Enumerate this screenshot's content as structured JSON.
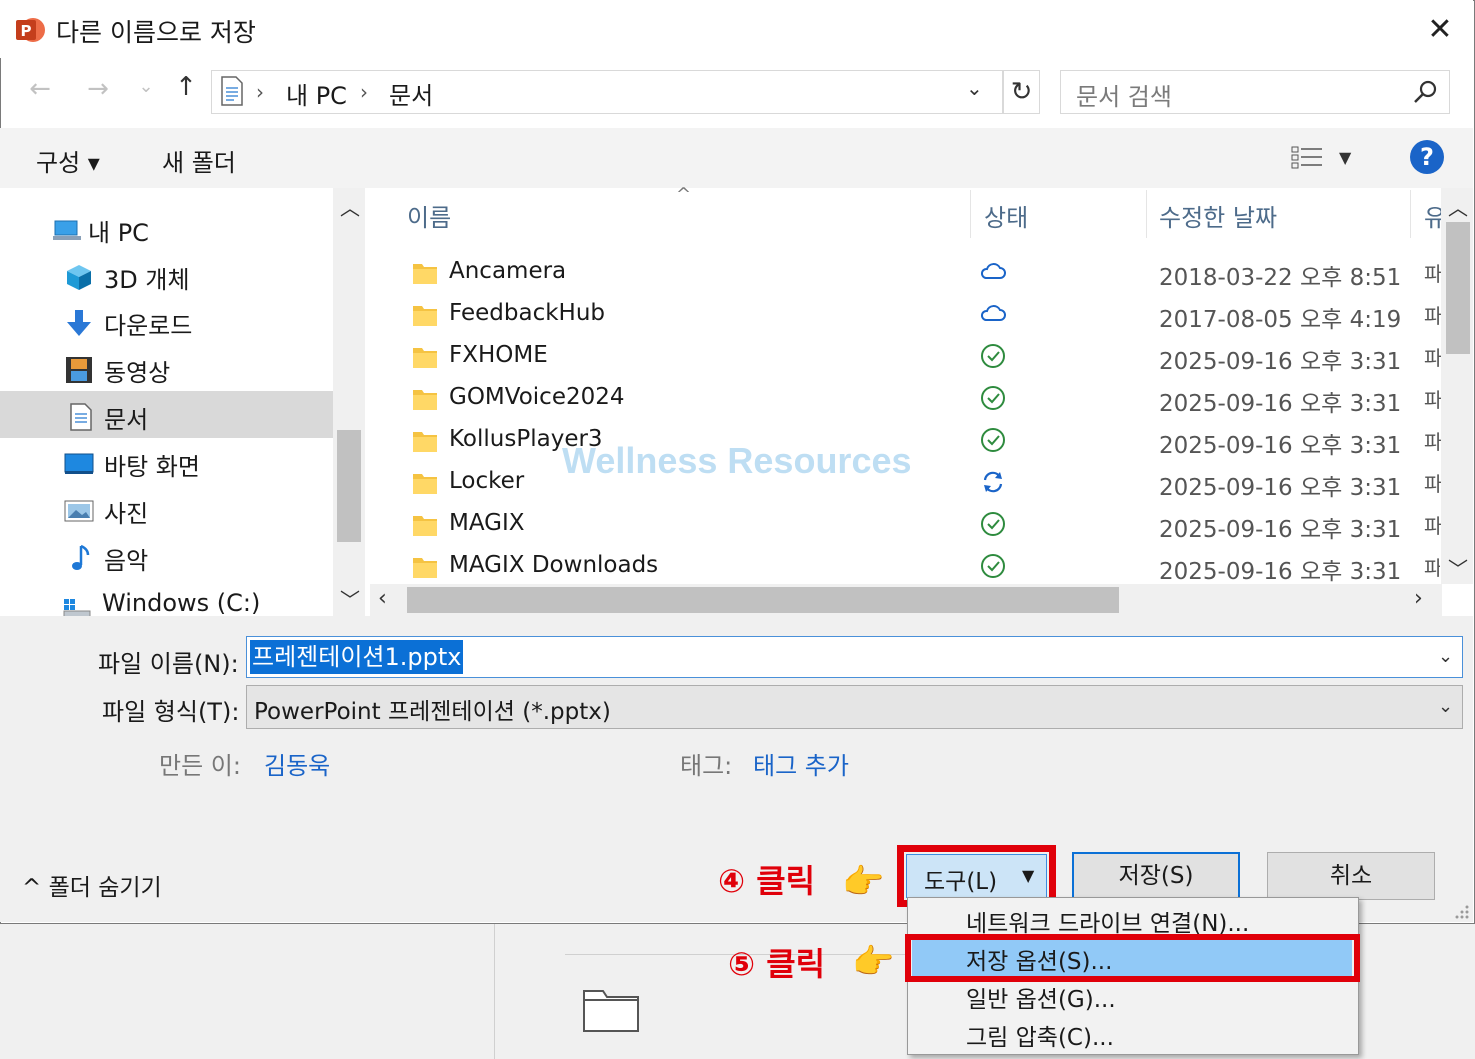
{
  "window": {
    "title": "다른 이름으로 저장",
    "close_glyph": "✕",
    "app_icon": "powerpoint-icon"
  },
  "address_bar": {
    "breadcrumb": [
      "내 PC",
      "문서"
    ],
    "separator": "›",
    "search_placeholder": "문서 검색"
  },
  "toolbar": {
    "organize_label": "구성 ▾",
    "new_folder_label": "새 폴더",
    "help_label": "?"
  },
  "nav_pane": {
    "items": [
      {
        "label": "내 PC",
        "icon": "computer-icon"
      },
      {
        "label": "3D 개체",
        "icon": "cube-3d-icon"
      },
      {
        "label": "다운로드",
        "icon": "download-arrow-icon"
      },
      {
        "label": "동영상",
        "icon": "film-icon"
      },
      {
        "label": "문서",
        "icon": "document-icon",
        "selected": true
      },
      {
        "label": "바탕 화면",
        "icon": "desktop-icon"
      },
      {
        "label": "사진",
        "icon": "picture-icon"
      },
      {
        "label": "음악",
        "icon": "music-note-icon"
      },
      {
        "label": "Windows (C:)",
        "icon": "drive-icon"
      }
    ]
  },
  "file_list": {
    "columns": [
      "이름",
      "상태",
      "수정한 날짜",
      "유"
    ],
    "rows": [
      {
        "name": "Ancamera",
        "status": "cloud",
        "date": "2018-03-22 오후 8:51",
        "type": "파"
      },
      {
        "name": "FeedbackHub",
        "status": "cloud",
        "date": "2017-08-05 오후 4:19",
        "type": "파"
      },
      {
        "name": "FXHOME",
        "status": "synced",
        "date": "2025-09-16 오후 3:31",
        "type": "파"
      },
      {
        "name": "GOMVoice2024",
        "status": "synced",
        "date": "2025-09-16 오후 3:31",
        "type": "파"
      },
      {
        "name": "KollusPlayer3",
        "status": "synced",
        "date": "2025-09-16 오후 3:31",
        "type": "파"
      },
      {
        "name": "Locker",
        "status": "syncing",
        "date": "2025-09-16 오후 3:31",
        "type": "파"
      },
      {
        "name": "MAGIX",
        "status": "synced",
        "date": "2025-09-16 오후 3:31",
        "type": "파"
      },
      {
        "name": "MAGIX Downloads",
        "status": "synced",
        "date": "2025-09-16 오후 3:31",
        "type": "파"
      }
    ],
    "watermark": "Wellness Resources"
  },
  "form": {
    "filename_label": "파일 이름(N):",
    "filename_value": "프레젠테이션1.pptx",
    "filetype_label": "파일 형식(T):",
    "filetype_value": "PowerPoint 프레젠테이션 (*.pptx)",
    "author_label": "만든 이:",
    "author_value": "김동욱",
    "tags_label": "태그:",
    "tags_value": "태그 추가"
  },
  "footer": {
    "hide_folders_label": "^  폴더 숨기기",
    "tools_label": "도구(L)",
    "save_label": "저장(S)",
    "cancel_label": "취소"
  },
  "tools_menu": {
    "items": [
      {
        "label": "네트워크 드라이브 연결(N)..."
      },
      {
        "label": "저장 옵션(S)...",
        "highlighted": true
      },
      {
        "label": "일반 옵션(G)..."
      },
      {
        "label": "그림 압축(C)..."
      }
    ]
  },
  "annotations": {
    "step4": "④ 클릭",
    "step5": "⑤ 클릭",
    "hand_glyph": "👉",
    "accent_color": "#e0000a"
  },
  "colors": {
    "selection_blue": "#0b70d6",
    "menu_highlight": "#91c9f7",
    "link_blue": "#1a64c8",
    "synced_green": "#2e8b3e",
    "cloud_blue": "#1a64c8"
  }
}
